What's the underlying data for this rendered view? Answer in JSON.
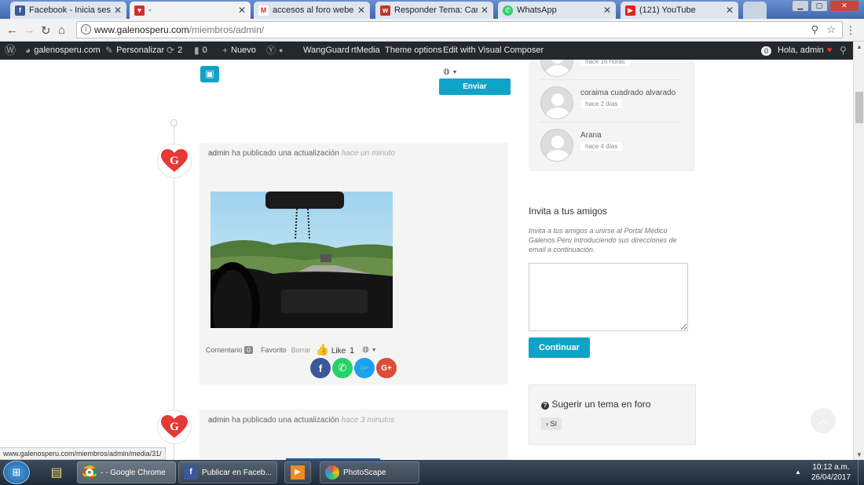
{
  "tabs": [
    {
      "title": "Facebook - Inicia sesión o",
      "icon": "facebook-icon",
      "color": "#3b5998"
    },
    {
      "title": "-",
      "icon": "site-icon",
      "color": "#d12f2f",
      "active": true
    },
    {
      "title": "accesos al foro webempre",
      "icon": "gmail-icon",
      "color": "#d93025"
    },
    {
      "title": "Responder Tema: Cambi",
      "icon": "site-w-icon",
      "color": "#c0392b"
    },
    {
      "title": "WhatsApp",
      "icon": "whatsapp-icon",
      "color": "#25d366"
    },
    {
      "title": "(121) YouTube",
      "icon": "youtube-icon",
      "color": "#e62117"
    }
  ],
  "address": {
    "host": "www.galenosperu.com",
    "path": "/miembros/admin/"
  },
  "wpbar": {
    "site": "galenosperu.com",
    "customize": "Personalizar",
    "updates": "2",
    "comments": "0",
    "new": "Nuevo",
    "wangguard": "WangGuard",
    "rtmedia": "rtMedia",
    "theme_options": "Theme options",
    "visual_composer": "Edit with Visual Composer",
    "notifications": "0",
    "greeting": "Hola, admin"
  },
  "composer": {
    "submit": "Enviar actualización"
  },
  "posts": [
    {
      "author": "admin",
      "action": "ha publicado una actualización",
      "time": "hace un minuto"
    },
    {
      "author": "admin",
      "action": "ha publicado una actualización",
      "time": "hace 3 minutos"
    }
  ],
  "post_actions": {
    "comment": "Comentario",
    "comment_count": "0",
    "favorite": "Favorito",
    "delete": "Borrar",
    "like": "Like",
    "like_count": "1"
  },
  "members": [
    {
      "name": "",
      "time": "hace 16 horas"
    },
    {
      "name": "coraima cuadrado alvarado",
      "time": "hace 2 días"
    },
    {
      "name": "Arana",
      "time": "hace 4 días"
    }
  ],
  "invite": {
    "title": "Invita a tus amigos",
    "description": "Invita a tus amigos a unirse al Portal Médico Galenos Peru introduciendo sus direcciones de email a continuación.",
    "button": "Continuar"
  },
  "suggest": {
    "title": "Sugerir un tema en foro",
    "button": "› Sí"
  },
  "status_url": "www.galenosperu.com/miembros/admin/media/31/",
  "taskbar": {
    "items": [
      "- - Google Chrome",
      "Publicar en Faceb...",
      "",
      "PhotoScape"
    ],
    "time": "10:12 a.m.",
    "date": "26/04/2017"
  }
}
